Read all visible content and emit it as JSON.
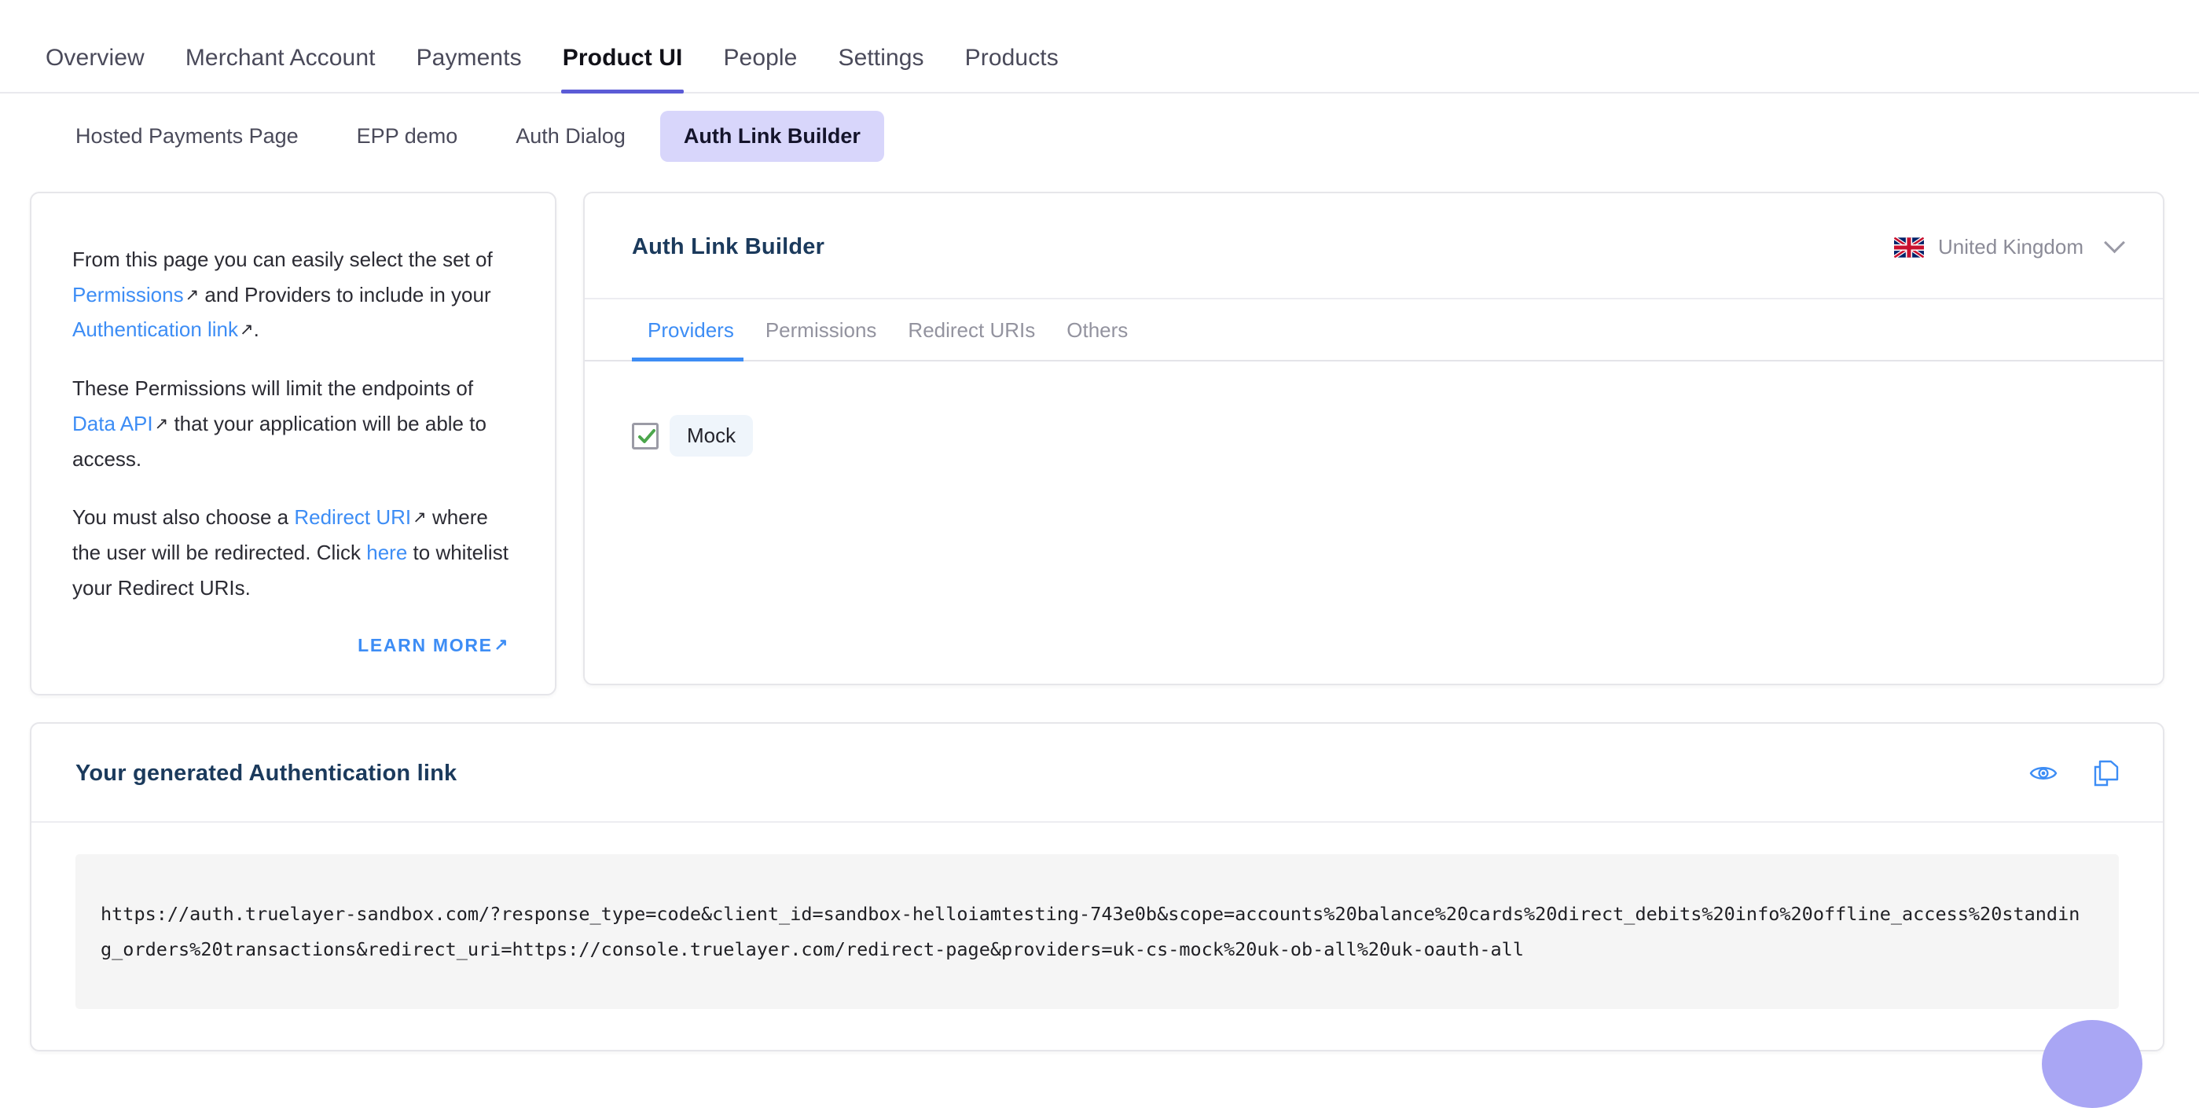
{
  "topnav": {
    "items": [
      {
        "label": "Overview",
        "active": false
      },
      {
        "label": "Merchant Account",
        "active": false
      },
      {
        "label": "Payments",
        "active": false
      },
      {
        "label": "Product UI",
        "active": true
      },
      {
        "label": "People",
        "active": false
      },
      {
        "label": "Settings",
        "active": false
      },
      {
        "label": "Products",
        "active": false
      }
    ]
  },
  "subtabs": {
    "items": [
      {
        "label": "Hosted Payments Page",
        "active": false
      },
      {
        "label": "EPP demo",
        "active": false
      },
      {
        "label": "Auth Dialog",
        "active": false
      },
      {
        "label": "Auth Link Builder",
        "active": true
      }
    ]
  },
  "info_card": {
    "p1_part1": "From this page you can easily select the set of ",
    "p1_link1": "Permissions",
    "p1_part2": " and Providers to include in your ",
    "p1_link2": "Authentication link",
    "p1_part3": ".",
    "p2_part1": "These Permissions will limit the endpoints of ",
    "p2_link1": "Data API",
    "p2_part2": " that your application will be able to access.",
    "p3_part1": "You must also choose a ",
    "p3_link1": "Redirect URI",
    "p3_part2": " where the user will be redirected. Click ",
    "p3_link2": "here",
    "p3_part3": " to whitelist your Redirect URIs.",
    "learn_more": "LEARN MORE",
    "ext_arrow": "↗"
  },
  "builder": {
    "title": "Auth Link Builder",
    "country": "United Kingdom",
    "country_flag": "uk-flag-icon",
    "tabs": [
      {
        "label": "Providers",
        "active": true
      },
      {
        "label": "Permissions",
        "active": false
      },
      {
        "label": "Redirect URIs",
        "active": false
      },
      {
        "label": "Others",
        "active": false
      }
    ],
    "providers": [
      {
        "label": "Mock",
        "checked": true
      }
    ]
  },
  "generated": {
    "title": "Your generated Authentication link",
    "preview_icon": "eye-icon",
    "copy_icon": "copy-icon",
    "url": "https://auth.truelayer-sandbox.com/?response_type=code&client_id=sandbox-helloiamtesting-743e0b&scope=accounts%20balance%20cards%20direct_debits%20info%20offline_access%20standing_orders%20transactions&redirect_uri=https://console.truelayer.com/redirect-page&providers=uk-cs-mock%20uk-ob-all%20uk-oauth-all"
  },
  "colors": {
    "accent_indigo": "#5b5bd6",
    "accent_blue": "#3d8df5",
    "title_navy": "#1b3a5c",
    "check_green": "#4ca64c",
    "pill_lavender": "#d8d6fb"
  }
}
